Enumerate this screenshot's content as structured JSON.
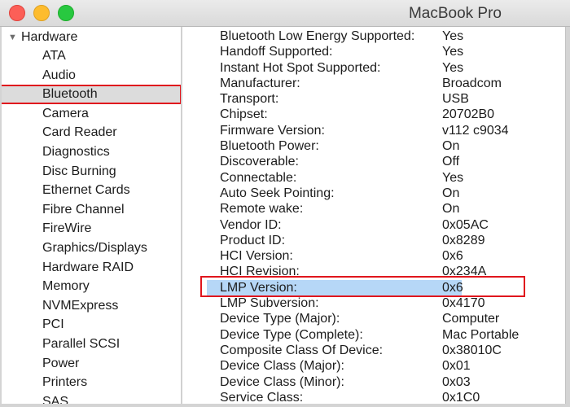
{
  "window": {
    "title": "MacBook Pro",
    "controls": [
      "close",
      "minimize",
      "zoom"
    ]
  },
  "sidebar": {
    "section_label": "Hardware",
    "section_icon": "disclosure-triangle-down",
    "items": [
      {
        "label": "ATA"
      },
      {
        "label": "Audio"
      },
      {
        "label": "Bluetooth",
        "selected": true
      },
      {
        "label": "Camera"
      },
      {
        "label": "Card Reader"
      },
      {
        "label": "Diagnostics"
      },
      {
        "label": "Disc Burning"
      },
      {
        "label": "Ethernet Cards"
      },
      {
        "label": "Fibre Channel"
      },
      {
        "label": "FireWire"
      },
      {
        "label": "Graphics/Displays"
      },
      {
        "label": "Hardware RAID"
      },
      {
        "label": "Memory"
      },
      {
        "label": "NVMExpress"
      },
      {
        "label": "PCI"
      },
      {
        "label": "Parallel SCSI"
      },
      {
        "label": "Power"
      },
      {
        "label": "Printers"
      },
      {
        "label": "SAS"
      }
    ]
  },
  "details": {
    "rows": [
      {
        "key": "Bluetooth Low Energy Supported:",
        "value": "Yes"
      },
      {
        "key": "Handoff Supported:",
        "value": "Yes"
      },
      {
        "key": "Instant Hot Spot Supported:",
        "value": "Yes"
      },
      {
        "key": "Manufacturer:",
        "value": "Broadcom"
      },
      {
        "key": "Transport:",
        "value": "USB"
      },
      {
        "key": "Chipset:",
        "value": "20702B0"
      },
      {
        "key": "Firmware Version:",
        "value": "v112 c9034"
      },
      {
        "key": "Bluetooth Power:",
        "value": "On"
      },
      {
        "key": "Discoverable:",
        "value": "Off"
      },
      {
        "key": "Connectable:",
        "value": "Yes"
      },
      {
        "key": "Auto Seek Pointing:",
        "value": "On"
      },
      {
        "key": "Remote wake:",
        "value": "On"
      },
      {
        "key": "Vendor ID:",
        "value": "0x05AC"
      },
      {
        "key": "Product ID:",
        "value": "0x8289"
      },
      {
        "key": "HCI Version:",
        "value": "0x6"
      },
      {
        "key": "HCI Revision:",
        "value": "0x234A"
      },
      {
        "key": "LMP Version:",
        "value": "0x6",
        "highlighted": true
      },
      {
        "key": "LMP Subversion:",
        "value": "0x4170"
      },
      {
        "key": "Device Type (Major):",
        "value": "Computer"
      },
      {
        "key": "Device Type (Complete):",
        "value": "Mac Portable"
      },
      {
        "key": "Composite Class Of Device:",
        "value": "0x38010C"
      },
      {
        "key": "Device Class (Major):",
        "value": "0x01"
      },
      {
        "key": "Device Class (Minor):",
        "value": "0x03"
      },
      {
        "key": "Service Class:",
        "value": "0x1C0"
      }
    ]
  },
  "colors": {
    "annotation_red": "#e0151d",
    "row_highlight": "#b6d7f7",
    "sidebar_selected": "#dcdcdc"
  }
}
